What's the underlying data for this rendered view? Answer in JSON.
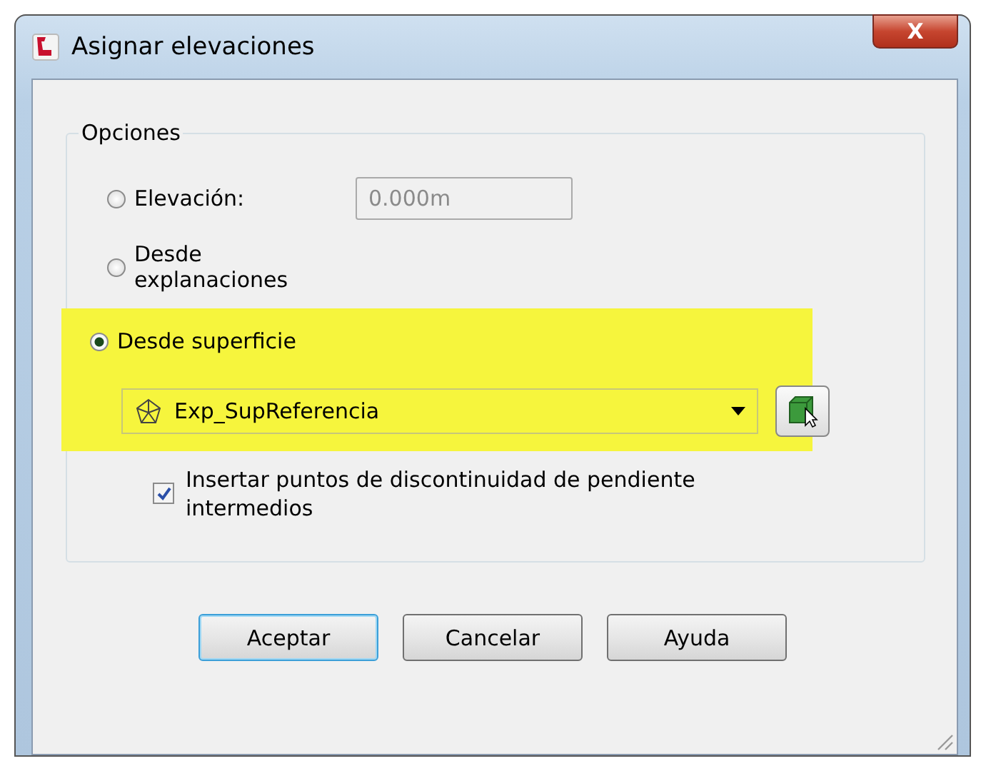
{
  "window": {
    "title": "Asignar elevaciones",
    "close": "X"
  },
  "group": {
    "title": "Opciones"
  },
  "options": [
    {
      "kind": "field",
      "label": "Elevación:",
      "selected": false,
      "value": "0.000m",
      "disabled": true
    },
    {
      "kind": "plain",
      "label": "Desde explanaciones",
      "selected": false
    },
    {
      "kind": "surface",
      "label": "Desde superficie",
      "selected": true,
      "highlighted": true,
      "combo": {
        "value": "Exp_SupReferencia"
      }
    }
  ],
  "checkbox": {
    "label": "Insertar puntos de discontinuidad de pendiente intermedios",
    "checked": true
  },
  "buttons": [
    {
      "label": "Aceptar",
      "default": true
    },
    {
      "label": "Cancelar",
      "default": false
    },
    {
      "label": "Ayuda",
      "default": false
    }
  ]
}
